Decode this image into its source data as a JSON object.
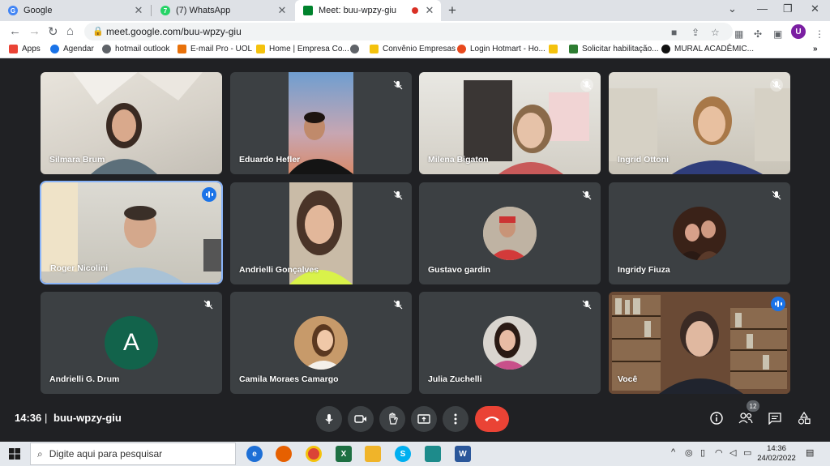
{
  "browser": {
    "tabs": [
      {
        "title": "Google",
        "icon": "google-icon",
        "active": false
      },
      {
        "title": "(7) WhatsApp",
        "icon": "whatsapp-icon",
        "active": false
      },
      {
        "title": "Meet: buu-wpzy-giu",
        "icon": "meet-icon",
        "active": true
      }
    ],
    "url": "meet.google.com/buu-wpzy-giu",
    "profile_letter": "U",
    "bookmarks": [
      {
        "label": "Apps",
        "color": "#ea4335"
      },
      {
        "label": "Agendar",
        "color": "#1a73e8"
      },
      {
        "label": "hotmail outlook",
        "color": "#5f6368"
      },
      {
        "label": "E-mail Pro - UOL",
        "color": "#e8710a"
      },
      {
        "label": "Home | Empresa Co...",
        "color": "#f4c20d"
      },
      {
        "label": "",
        "color": "#5f6368"
      },
      {
        "label": "Convênio Empresas",
        "color": "#f4c20d"
      },
      {
        "label": "Login Hotmart - Ho...",
        "color": "#e8491d"
      },
      {
        "label": "",
        "color": "#f4c20d"
      },
      {
        "label": "Solicitar habilitação...",
        "color": "#2e7d32"
      },
      {
        "label": "MURAL ACADÊMIC...",
        "color": "#111111"
      }
    ]
  },
  "participants": [
    {
      "name": "Silmara Brum",
      "muted": false,
      "speaking": false
    },
    {
      "name": "Eduardo Hefler",
      "muted": true,
      "speaking": false
    },
    {
      "name": "Milena Bigaton",
      "muted": true,
      "speaking": false
    },
    {
      "name": "Ingrid Ottoni",
      "muted": true,
      "speaking": false
    },
    {
      "name": "Roger Nicolini",
      "muted": false,
      "speaking": true
    },
    {
      "name": "Andrielli Gonçalves",
      "muted": true,
      "speaking": false
    },
    {
      "name": "Gustavo gardin",
      "muted": true,
      "speaking": false
    },
    {
      "name": "Ingridy Fiuza",
      "muted": true,
      "speaking": false
    },
    {
      "name": "Andrielli G. Drum",
      "muted": true,
      "speaking": false,
      "initial": "A"
    },
    {
      "name": "Camila Moraes Camargo",
      "muted": true,
      "speaking": false
    },
    {
      "name": "Julia Zuchelli",
      "muted": true,
      "speaking": false
    },
    {
      "name": "Você",
      "muted": false,
      "speaking": true
    }
  ],
  "meeting": {
    "time": "14:36",
    "separator": "|",
    "code": "buu-wpzy-giu",
    "people_count": "12"
  },
  "taskbar": {
    "search_placeholder": "Digite aqui para pesquisar",
    "clock_time": "14:36",
    "clock_date": "24/02/2022"
  }
}
